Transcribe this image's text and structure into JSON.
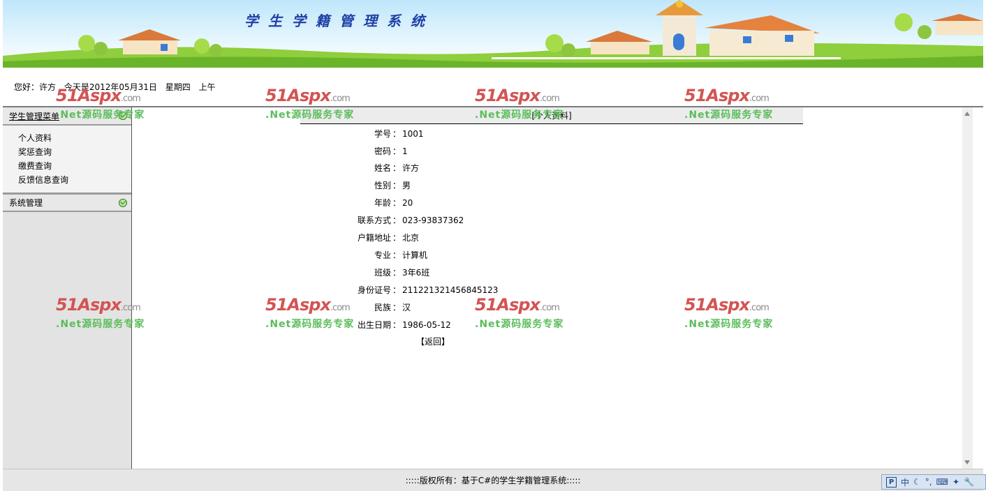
{
  "banner": {
    "title": "学生学籍管理系统"
  },
  "greeting": {
    "hello": "您好：许方",
    "today": "今天是2012年05月31日",
    "weekday": "星期四",
    "period": "上午"
  },
  "sidebar": {
    "menu_title": "学生管理菜单",
    "items": [
      {
        "label": "个人资料"
      },
      {
        "label": "奖惩查询"
      },
      {
        "label": "缴费查询"
      },
      {
        "label": "反馈信息查询"
      }
    ],
    "system_title": "系统管理"
  },
  "profile": {
    "header": "[个人资料]",
    "separator": "：",
    "fields": [
      {
        "label": "学号",
        "value": "1001"
      },
      {
        "label": "密码",
        "value": "1"
      },
      {
        "label": "姓名",
        "value": "许方"
      },
      {
        "label": "性别",
        "value": "男"
      },
      {
        "label": "年龄",
        "value": "20"
      },
      {
        "label": "联系方式",
        "value": "023-93837362"
      },
      {
        "label": "户籍地址",
        "value": "北京"
      },
      {
        "label": "专业",
        "value": "计算机"
      },
      {
        "label": "班级",
        "value": "3年6班"
      },
      {
        "label": "身份证号",
        "value": "211221321456845123"
      },
      {
        "label": "民族",
        "value": "汉"
      },
      {
        "label": "出生日期",
        "value": "1986-05-12"
      }
    ],
    "return_label": "【返回】"
  },
  "footer": {
    "text": ":::::版权所有：基于C#的学生学籍管理系统:::::"
  },
  "ime": {
    "mode": "中",
    "p_label": "P"
  },
  "watermark": {
    "logo_main": "51Aspx",
    "logo_suffix": ".com",
    "tagline": ".Net源码服务专家"
  }
}
